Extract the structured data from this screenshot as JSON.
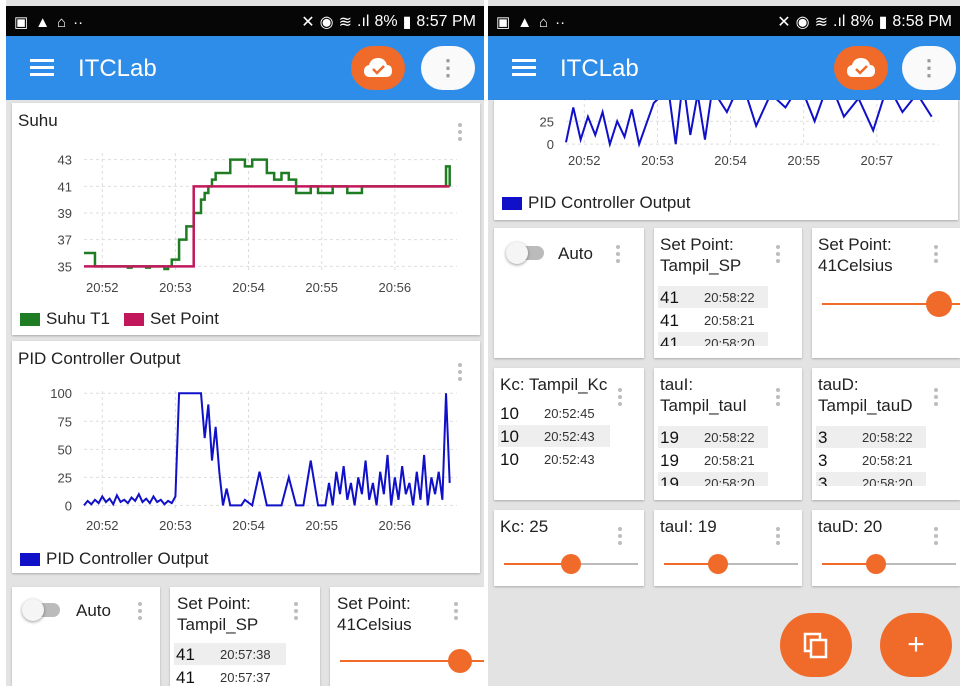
{
  "left": {
    "status": {
      "battery": "8%",
      "time": "8:57 PM"
    },
    "app_title": "ITCLab",
    "chart1": {
      "title": "Suhu",
      "legend": [
        "Suhu T1",
        "Set Point"
      ]
    },
    "chart2": {
      "title": "PID Controller Output",
      "legend": [
        "PID Controller Output"
      ]
    },
    "auto_label": "Auto",
    "setpoint_display": {
      "title": "Set Point: Tampil_SP",
      "rows": [
        {
          "v": "41",
          "t": "20:57:38"
        },
        {
          "v": "41",
          "t": "20:57:37"
        }
      ]
    },
    "setpoint_slider": {
      "title": "Set Point: 41Celsius"
    }
  },
  "right": {
    "status": {
      "battery": "8%",
      "time": "8:58 PM"
    },
    "app_title": "ITCLab",
    "chart_legend": "PID Controller Output",
    "auto_label": "Auto",
    "setpoint_display": {
      "title": "Set Point: Tampil_SP",
      "rows": [
        {
          "v": "41",
          "t": "20:58:22"
        },
        {
          "v": "41",
          "t": "20:58:21"
        },
        {
          "v": "41",
          "t": "20:58:20"
        }
      ]
    },
    "setpoint_slider": {
      "title": "Set Point: 41Celsius"
    },
    "kc_display": {
      "title": "Kc: Tampil_Kc",
      "rows": [
        {
          "v": "10",
          "t": "20:52:45"
        },
        {
          "v": "10",
          "t": "20:52:43"
        },
        {
          "v": "10",
          "t": "20:52:43"
        }
      ]
    },
    "taui_display": {
      "title": "tauI: Tampil_tauI",
      "rows": [
        {
          "v": "19",
          "t": "20:58:22"
        },
        {
          "v": "19",
          "t": "20:58:21"
        },
        {
          "v": "19",
          "t": "20:58:20"
        }
      ]
    },
    "taud_display": {
      "title": "tauD: Tampil_tauD",
      "rows": [
        {
          "v": "3",
          "t": "20:58:22"
        },
        {
          "v": "3",
          "t": "20:58:21"
        },
        {
          "v": "3",
          "t": "20:58:20"
        }
      ]
    },
    "kc_slider": {
      "title": "Kc: 25",
      "level": 0.5
    },
    "taui_slider": {
      "title": "tauI: 19",
      "level": 0.4
    },
    "taud_slider": {
      "title": "tauD: 20",
      "level": 0.4
    }
  },
  "colors": {
    "appbar": "#2e8de8",
    "accent": "#f06a2a",
    "suhu": "#1e7d22",
    "setpoint": "#c2185b",
    "pid": "#1010c8"
  },
  "chart_data": [
    {
      "type": "line",
      "title": "Suhu",
      "x_ticks": [
        "20:52",
        "20:53",
        "20:54",
        "20:55",
        "20:56"
      ],
      "y_ticks": [
        35,
        37,
        39,
        41,
        43
      ],
      "ylim": [
        34.5,
        43.5
      ],
      "series": [
        {
          "name": "Suhu T1",
          "color": "#1e7d22",
          "x": [
            0,
            0.12,
            0.15,
            0.25,
            0.3,
            0.5,
            0.6,
            0.65,
            0.75,
            0.85,
            0.9,
            1,
            1.05,
            1.1,
            1.15,
            1.2,
            1.25,
            1.3,
            1.35,
            1.4,
            1.45,
            1.5,
            1.55,
            1.6,
            1.65,
            1.7,
            1.75,
            1.8,
            1.9,
            2.0,
            2.1,
            2.15,
            2.2,
            2.3,
            2.4,
            2.5,
            2.55,
            2.6,
            2.65,
            2.7,
            2.75,
            2.8,
            2.9,
            3.0,
            3.1,
            3.2,
            3.3,
            3.4,
            3.5,
            3.6,
            3.7,
            3.8,
            3.9,
            4.0,
            4.5,
            4.9,
            4.95,
            5.0
          ],
          "y": [
            36,
            36,
            35,
            35,
            35,
            35,
            34.9,
            35,
            35,
            34.9,
            35,
            35,
            35,
            34.8,
            35,
            35.5,
            35.5,
            37,
            37,
            38,
            38,
            39,
            39,
            40,
            40.5,
            41,
            41.5,
            42,
            42,
            43,
            43,
            43,
            42.5,
            43,
            43,
            42,
            42,
            41.5,
            41.5,
            42,
            42,
            41.5,
            40.5,
            40.5,
            41,
            40.5,
            40.5,
            41,
            41,
            40.5,
            40.5,
            41,
            41,
            41,
            41,
            41,
            42.5,
            41
          ]
        },
        {
          "name": "Set Point",
          "color": "#c2185b",
          "x": [
            0,
            1.2,
            1.5,
            5.0
          ],
          "y": [
            35,
            35,
            41,
            41
          ]
        }
      ]
    },
    {
      "type": "line",
      "title": "PID Controller Output",
      "x_ticks": [
        "20:52",
        "20:53",
        "20:54",
        "20:55",
        "20:56"
      ],
      "y_ticks": [
        0,
        25,
        50,
        75,
        100
      ],
      "ylim": [
        -5,
        102
      ],
      "series": [
        {
          "name": "PID Controller Output",
          "color": "#1010c8",
          "x": [
            0,
            0.05,
            0.1,
            0.15,
            0.2,
            0.25,
            0.3,
            0.35,
            0.4,
            0.45,
            0.5,
            0.55,
            0.6,
            0.65,
            0.7,
            0.75,
            0.8,
            0.85,
            0.9,
            0.95,
            1.0,
            1.05,
            1.1,
            1.15,
            1.2,
            1.25,
            1.3,
            1.35,
            1.4,
            1.5,
            1.6,
            1.65,
            1.7,
            1.75,
            1.8,
            1.85,
            1.9,
            1.95,
            2.0,
            2.05,
            2.1,
            2.15,
            2.2,
            2.3,
            2.4,
            2.5,
            2.6,
            2.7,
            2.8,
            2.9,
            3.0,
            3.1,
            3.2,
            3.3,
            3.35,
            3.4,
            3.45,
            3.5,
            3.55,
            3.6,
            3.65,
            3.7,
            3.75,
            3.8,
            3.85,
            3.9,
            3.95,
            4.0,
            4.05,
            4.1,
            4.15,
            4.2,
            4.25,
            4.3,
            4.35,
            4.4,
            4.45,
            4.5,
            4.55,
            4.6,
            4.65,
            4.7,
            4.75,
            4.8,
            4.85,
            4.9,
            4.95,
            5.0
          ],
          "y": [
            0,
            4,
            1,
            5,
            2,
            8,
            3,
            6,
            1,
            9,
            3,
            5,
            2,
            7,
            4,
            10,
            3,
            6,
            2,
            8,
            3,
            5,
            1,
            4,
            2,
            8,
            100,
            100,
            100,
            100,
            100,
            60,
            90,
            40,
            70,
            30,
            0,
            15,
            0,
            0,
            0,
            0,
            5,
            0,
            30,
            0,
            0,
            0,
            25,
            0,
            0,
            40,
            0,
            0,
            20,
            0,
            30,
            10,
            35,
            5,
            20,
            0,
            25,
            10,
            40,
            5,
            20,
            0,
            30,
            10,
            45,
            0,
            25,
            5,
            35,
            10,
            20,
            0,
            30,
            5,
            45,
            0,
            25,
            10,
            30,
            5,
            100,
            20
          ]
        }
      ]
    },
    {
      "type": "line",
      "title": "",
      "x_ticks": [
        "20:52",
        "20:53",
        "20:54",
        "20:55",
        "20:57"
      ],
      "y_ticks": [
        0,
        25
      ],
      "series": [
        {
          "name": "PID Controller Output",
          "color": "#1010c8",
          "x": [
            0,
            0.1,
            0.2,
            0.3,
            0.4,
            0.5,
            0.6,
            0.7,
            0.8,
            0.9,
            1.0,
            1.2,
            1.4,
            1.5,
            1.6,
            1.7,
            1.8,
            1.9,
            2.0,
            2.2,
            2.4,
            2.6,
            2.8,
            3.0,
            3.2,
            3.4,
            3.6,
            3.8,
            4.0,
            4.2,
            4.4,
            4.6,
            4.8,
            5.0
          ],
          "y": [
            2,
            40,
            5,
            30,
            10,
            35,
            0,
            25,
            8,
            38,
            0,
            45,
            60,
            0,
            70,
            10,
            55,
            5,
            60,
            35,
            70,
            20,
            55,
            40,
            65,
            25,
            70,
            30,
            50,
            15,
            65,
            35,
            55,
            30
          ]
        }
      ]
    }
  ]
}
